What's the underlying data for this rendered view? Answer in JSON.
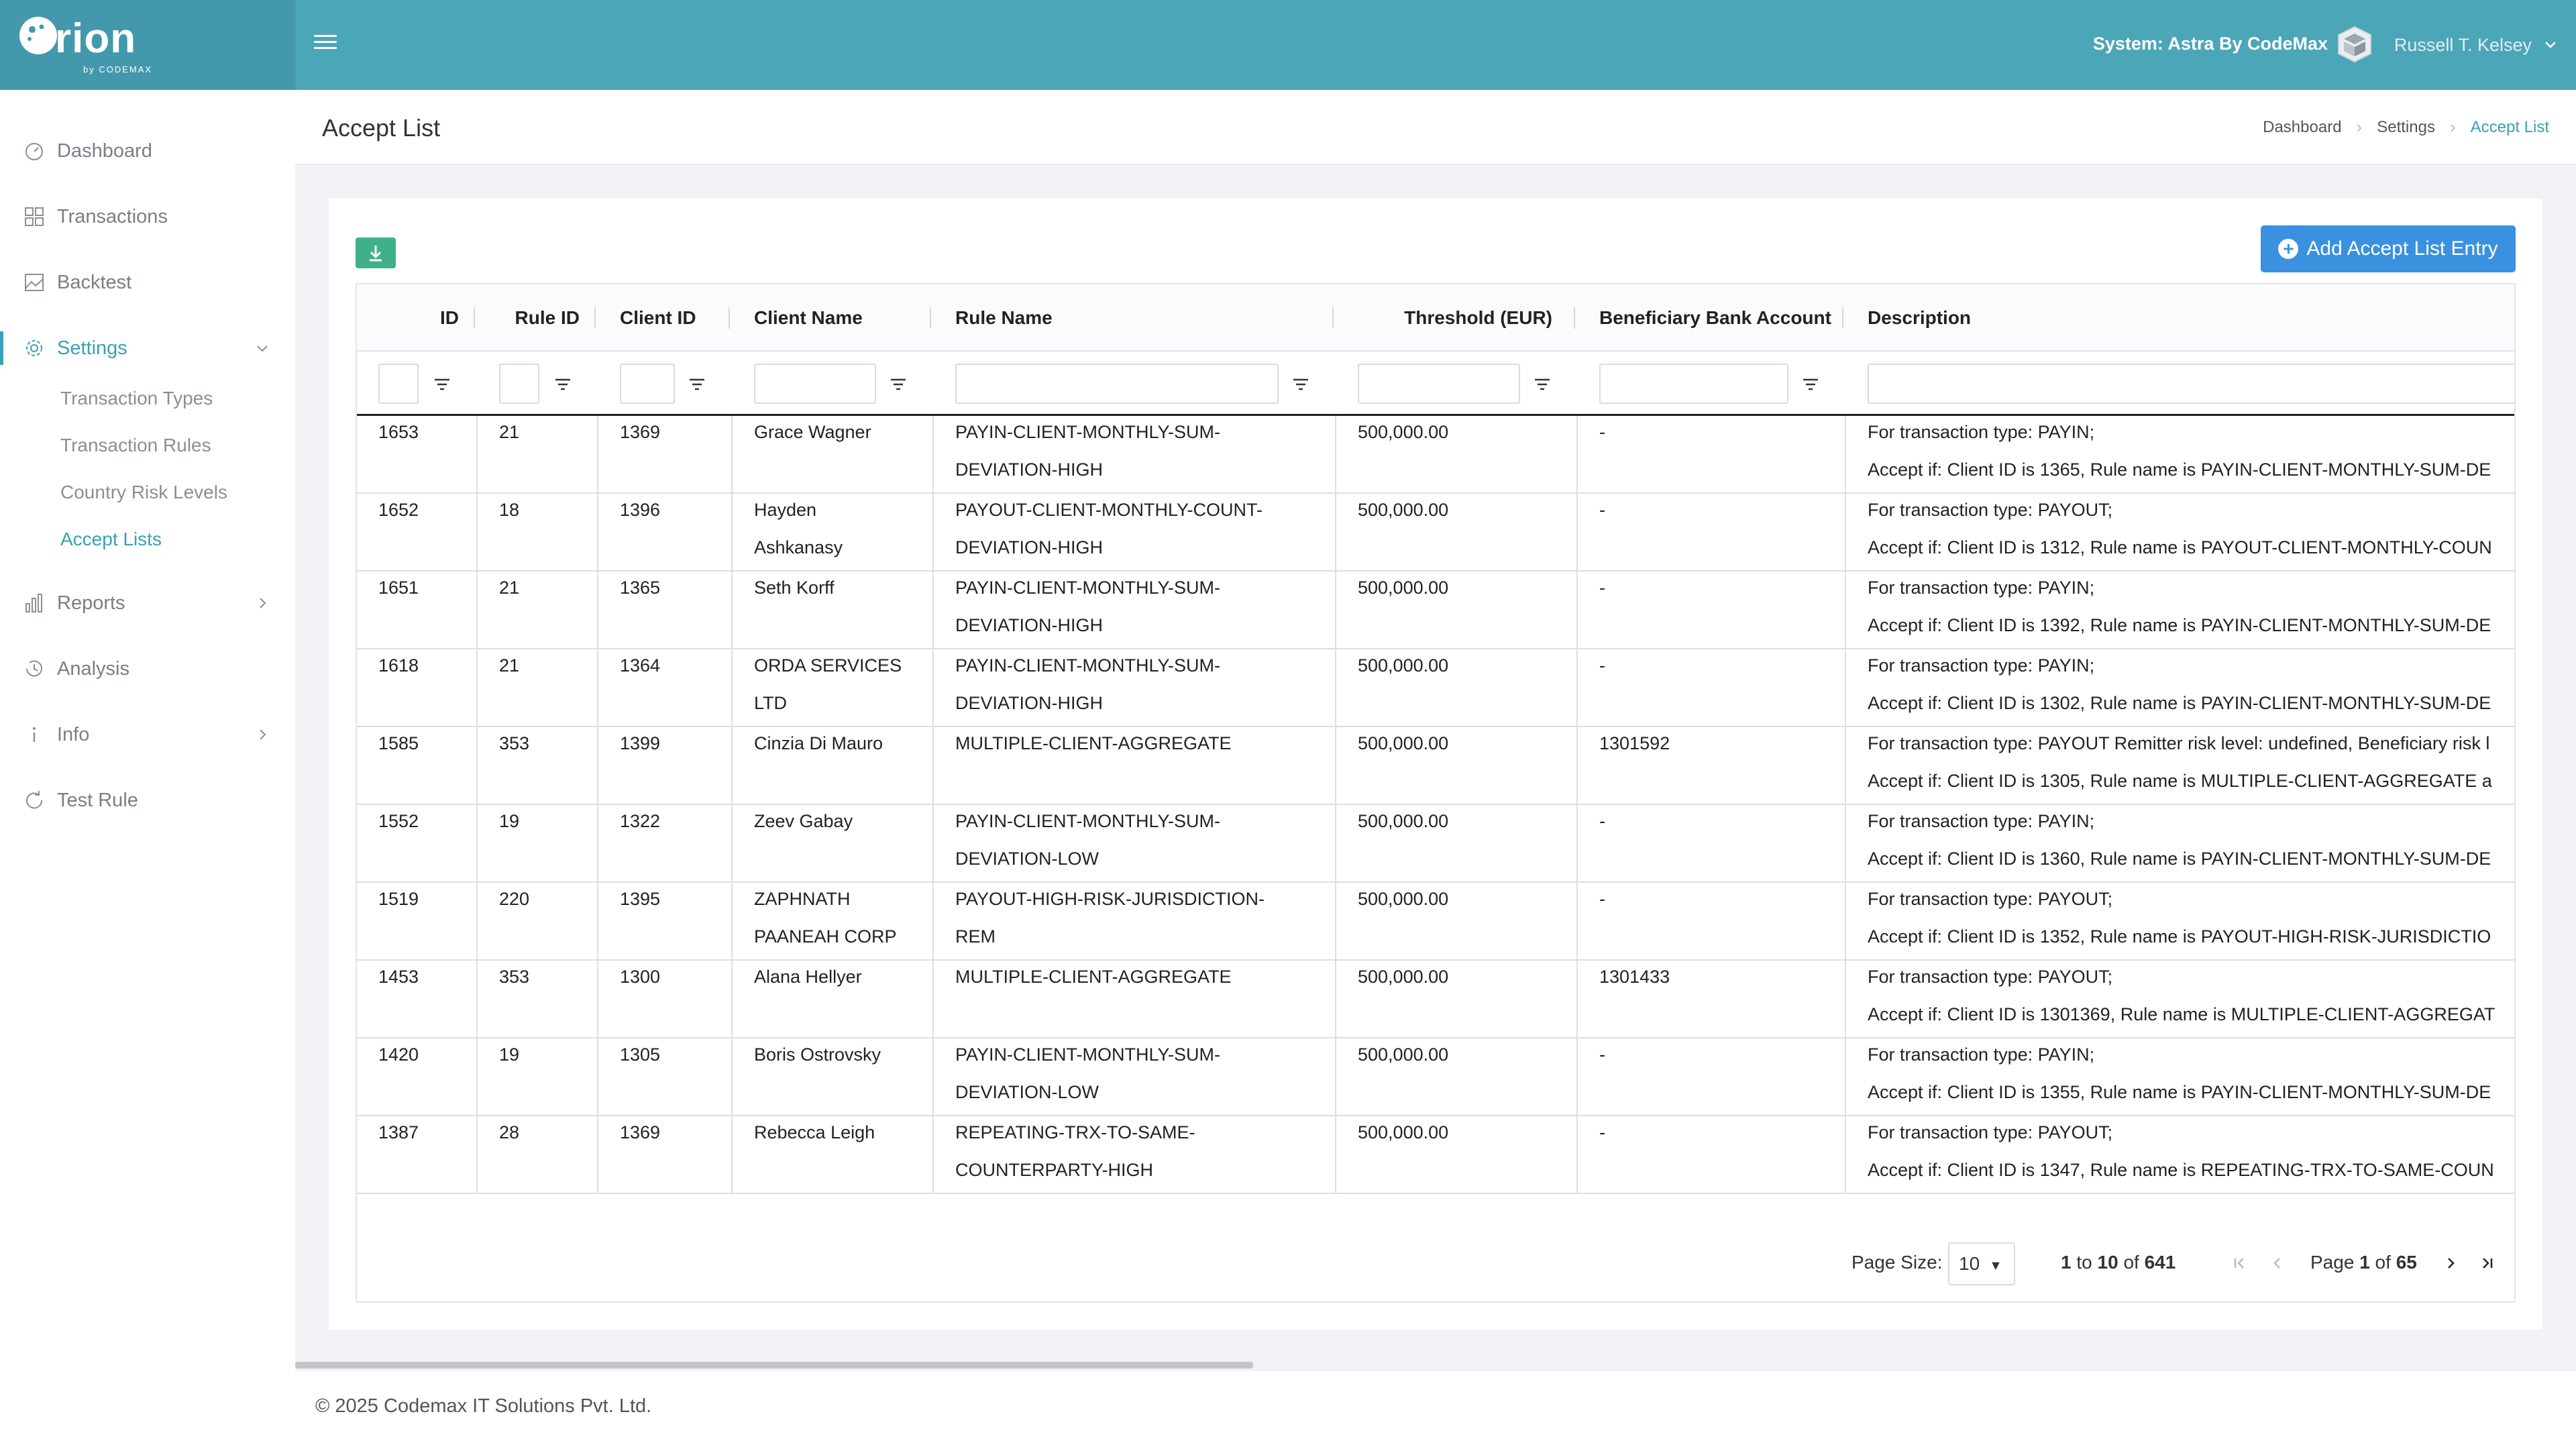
{
  "brand": {
    "name": "rion",
    "sub": "by CODEMAX"
  },
  "header": {
    "system_label": "System: Astra By CodeMax",
    "user_name": "Russell T. Kelsey"
  },
  "sidebar": {
    "items": [
      {
        "label": "Dashboard",
        "icon": "dashboard-icon"
      },
      {
        "label": "Transactions",
        "icon": "grid-icon"
      },
      {
        "label": "Backtest",
        "icon": "image-chart-icon"
      },
      {
        "label": "Settings",
        "icon": "gear-icon"
      },
      {
        "label": "Reports",
        "icon": "bar-chart-icon"
      },
      {
        "label": "Analysis",
        "icon": "history-icon"
      },
      {
        "label": "Info",
        "icon": "info-icon"
      },
      {
        "label": "Test Rule",
        "icon": "refresh-icon"
      }
    ],
    "settings_sub": [
      "Transaction Types",
      "Transaction Rules",
      "Country Risk Levels",
      "Accept Lists"
    ]
  },
  "page": {
    "title": "Accept List",
    "breadcrumb": [
      "Dashboard",
      "Settings",
      "Accept List"
    ],
    "add_button": "Add Accept List Entry"
  },
  "table": {
    "columns": [
      "ID",
      "Rule ID",
      "Client ID",
      "Client Name",
      "Rule Name",
      "Threshold (EUR)",
      "Beneficiary Bank Account",
      "Description"
    ],
    "rows": [
      {
        "id": "1653",
        "rule_id": "21",
        "client_id": "1369",
        "client_name": [
          "Grace Wagner",
          ""
        ],
        "rule_name": [
          "PAYIN-CLIENT-MONTHLY-SUM-",
          "DEVIATION-HIGH"
        ],
        "threshold": "500,000.00",
        "account": "-",
        "desc": [
          "For transaction type: PAYIN;",
          "Accept if: Client ID is 1365, Rule name is PAYIN-CLIENT-MONTHLY-SUM-DE"
        ]
      },
      {
        "id": "1652",
        "rule_id": "18",
        "client_id": "1396",
        "client_name": [
          "Hayden",
          "Ashkanasy"
        ],
        "rule_name": [
          "PAYOUT-CLIENT-MONTHLY-COUNT-",
          "DEVIATION-HIGH"
        ],
        "threshold": "500,000.00",
        "account": "-",
        "desc": [
          "For transaction type: PAYOUT;",
          "Accept if: Client ID is 1312, Rule name is PAYOUT-CLIENT-MONTHLY-COUN"
        ]
      },
      {
        "id": "1651",
        "rule_id": "21",
        "client_id": "1365",
        "client_name": [
          "Seth Korff",
          ""
        ],
        "rule_name": [
          "PAYIN-CLIENT-MONTHLY-SUM-",
          "DEVIATION-HIGH"
        ],
        "threshold": "500,000.00",
        "account": "-",
        "desc": [
          "For transaction type: PAYIN;",
          "Accept if: Client ID is 1392, Rule name is PAYIN-CLIENT-MONTHLY-SUM-DE"
        ]
      },
      {
        "id": "1618",
        "rule_id": "21",
        "client_id": "1364",
        "client_name": [
          "ORDA SERVICES",
          "LTD"
        ],
        "rule_name": [
          "PAYIN-CLIENT-MONTHLY-SUM-",
          "DEVIATION-HIGH"
        ],
        "threshold": "500,000.00",
        "account": "-",
        "desc": [
          "For transaction type: PAYIN;",
          "Accept if: Client ID is 1302, Rule name is PAYIN-CLIENT-MONTHLY-SUM-DE"
        ]
      },
      {
        "id": "1585",
        "rule_id": "353",
        "client_id": "1399",
        "client_name": [
          "Cinzia Di Mauro",
          ""
        ],
        "rule_name": [
          "MULTIPLE-CLIENT-AGGREGATE",
          ""
        ],
        "threshold": "500,000.00",
        "account": "1301592",
        "desc": [
          "For transaction type: PAYOUT Remitter risk level: undefined, Beneficiary risk l",
          "Accept if: Client ID is 1305, Rule name is MULTIPLE-CLIENT-AGGREGATE a"
        ]
      },
      {
        "id": "1552",
        "rule_id": "19",
        "client_id": "1322",
        "client_name": [
          "Zeev Gabay",
          ""
        ],
        "rule_name": [
          "PAYIN-CLIENT-MONTHLY-SUM-",
          "DEVIATION-LOW"
        ],
        "threshold": "500,000.00",
        "account": "-",
        "desc": [
          "For transaction type: PAYIN;",
          "Accept if: Client ID is 1360, Rule name is PAYIN-CLIENT-MONTHLY-SUM-DE"
        ]
      },
      {
        "id": "1519",
        "rule_id": "220",
        "client_id": "1395",
        "client_name": [
          "ZAPHNATH",
          "PAANEAH CORP"
        ],
        "rule_name": [
          "PAYOUT-HIGH-RISK-JURISDICTION-",
          "REM"
        ],
        "threshold": "500,000.00",
        "account": "-",
        "desc": [
          "For transaction type: PAYOUT;",
          "Accept if: Client ID is 1352, Rule name is PAYOUT-HIGH-RISK-JURISDICTIO"
        ]
      },
      {
        "id": "1453",
        "rule_id": "353",
        "client_id": "1300",
        "client_name": [
          "Alana Hellyer",
          ""
        ],
        "rule_name": [
          "MULTIPLE-CLIENT-AGGREGATE",
          ""
        ],
        "threshold": "500,000.00",
        "account": "1301433",
        "desc": [
          "For transaction type: PAYOUT;",
          "Accept if: Client ID is 1301369, Rule name is MULTIPLE-CLIENT-AGGREGAT"
        ]
      },
      {
        "id": "1420",
        "rule_id": "19",
        "client_id": "1305",
        "client_name": [
          "Boris Ostrovsky",
          ""
        ],
        "rule_name": [
          "PAYIN-CLIENT-MONTHLY-SUM-",
          "DEVIATION-LOW"
        ],
        "threshold": "500,000.00",
        "account": "-",
        "desc": [
          "For transaction type: PAYIN;",
          "Accept if: Client ID is 1355, Rule name is PAYIN-CLIENT-MONTHLY-SUM-DE"
        ]
      },
      {
        "id": "1387",
        "rule_id": "28",
        "client_id": "1369",
        "client_name": [
          "Rebecca Leigh",
          ""
        ],
        "rule_name": [
          "REPEATING-TRX-TO-SAME-",
          "COUNTERPARTY-HIGH"
        ],
        "threshold": "500,000.00",
        "account": "-",
        "desc": [
          "For transaction type: PAYOUT;",
          "Accept if: Client ID is 1347, Rule name is REPEATING-TRX-TO-SAME-COUN"
        ]
      }
    ]
  },
  "pager": {
    "page_size_label": "Page Size:",
    "page_size": "10",
    "range_from": "1",
    "range_to_word": "to",
    "range_to": "10",
    "range_of_word": "of",
    "total": "641",
    "page_word": "Page",
    "page": "1",
    "page_of_word": "of",
    "pages": "65"
  },
  "footer": {
    "copyright": "© 2025 Codemax IT Solutions Pvt. Ltd."
  },
  "colors": {
    "topbar": "#4ba6b7",
    "accent": "#3aa0b5",
    "add_button": "#3a91e0",
    "export_button": "#3fb18a"
  }
}
